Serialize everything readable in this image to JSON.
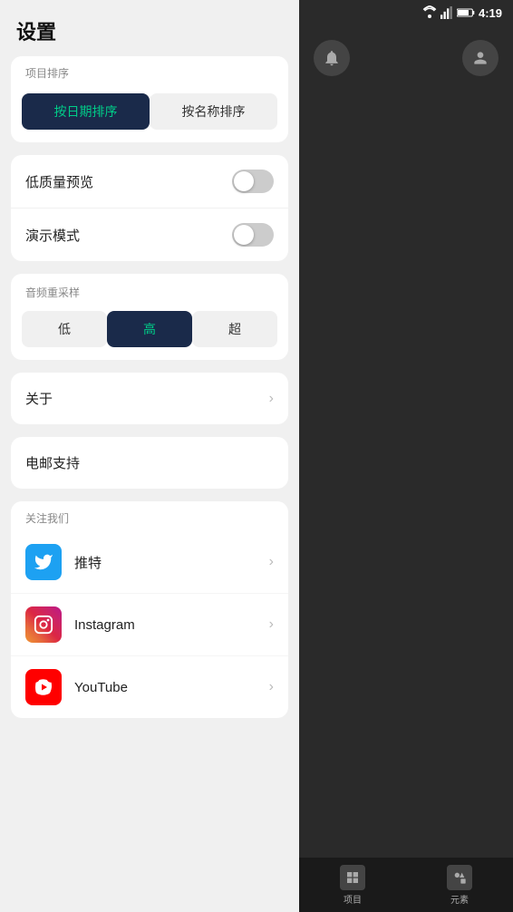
{
  "statusBar": {
    "time": "4:19"
  },
  "settings": {
    "title": "设置",
    "sortSection": {
      "label": "项目排序",
      "buttons": [
        {
          "id": "date",
          "label": "按日期排序",
          "active": true
        },
        {
          "id": "name",
          "label": "按名称排序",
          "active": false
        }
      ]
    },
    "toggles": [
      {
        "id": "low-quality",
        "label": "低质量预览",
        "active": false
      },
      {
        "id": "demo-mode",
        "label": "演示模式",
        "active": false
      }
    ],
    "resampleSection": {
      "label": "音频重采样",
      "buttons": [
        {
          "id": "low",
          "label": "低",
          "active": false
        },
        {
          "id": "high",
          "label": "高",
          "active": true
        },
        {
          "id": "ultra",
          "label": "超",
          "active": false
        }
      ]
    },
    "about": {
      "label": "关于"
    },
    "emailSupport": {
      "label": "电邮支持"
    },
    "followSection": {
      "label": "关注我们",
      "items": [
        {
          "id": "twitter",
          "name": "推特",
          "icon": "twitter"
        },
        {
          "id": "instagram",
          "name": "Instagram",
          "icon": "instagram"
        },
        {
          "id": "youtube",
          "name": "YouTube",
          "icon": "youtube"
        }
      ]
    }
  },
  "rightPanel": {
    "bottomNav": [
      {
        "id": "projects",
        "label": "项目"
      },
      {
        "id": "elements",
        "label": "元素"
      }
    ]
  }
}
